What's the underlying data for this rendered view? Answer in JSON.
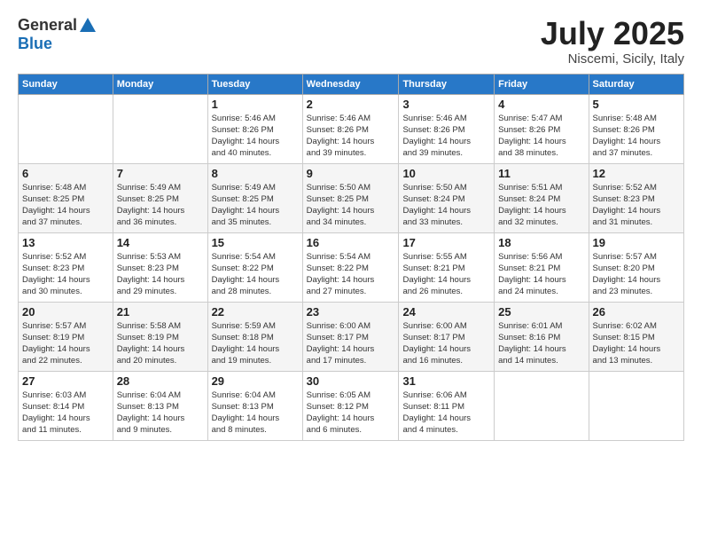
{
  "logo": {
    "general": "General",
    "blue": "Blue"
  },
  "title": "July 2025",
  "subtitle": "Niscemi, Sicily, Italy",
  "days_header": [
    "Sunday",
    "Monday",
    "Tuesday",
    "Wednesday",
    "Thursday",
    "Friday",
    "Saturday"
  ],
  "weeks": [
    [
      {
        "day": "",
        "info": ""
      },
      {
        "day": "",
        "info": ""
      },
      {
        "day": "1",
        "info": "Sunrise: 5:46 AM\nSunset: 8:26 PM\nDaylight: 14 hours\nand 40 minutes."
      },
      {
        "day": "2",
        "info": "Sunrise: 5:46 AM\nSunset: 8:26 PM\nDaylight: 14 hours\nand 39 minutes."
      },
      {
        "day": "3",
        "info": "Sunrise: 5:46 AM\nSunset: 8:26 PM\nDaylight: 14 hours\nand 39 minutes."
      },
      {
        "day": "4",
        "info": "Sunrise: 5:47 AM\nSunset: 8:26 PM\nDaylight: 14 hours\nand 38 minutes."
      },
      {
        "day": "5",
        "info": "Sunrise: 5:48 AM\nSunset: 8:26 PM\nDaylight: 14 hours\nand 37 minutes."
      }
    ],
    [
      {
        "day": "6",
        "info": "Sunrise: 5:48 AM\nSunset: 8:25 PM\nDaylight: 14 hours\nand 37 minutes."
      },
      {
        "day": "7",
        "info": "Sunrise: 5:49 AM\nSunset: 8:25 PM\nDaylight: 14 hours\nand 36 minutes."
      },
      {
        "day": "8",
        "info": "Sunrise: 5:49 AM\nSunset: 8:25 PM\nDaylight: 14 hours\nand 35 minutes."
      },
      {
        "day": "9",
        "info": "Sunrise: 5:50 AM\nSunset: 8:25 PM\nDaylight: 14 hours\nand 34 minutes."
      },
      {
        "day": "10",
        "info": "Sunrise: 5:50 AM\nSunset: 8:24 PM\nDaylight: 14 hours\nand 33 minutes."
      },
      {
        "day": "11",
        "info": "Sunrise: 5:51 AM\nSunset: 8:24 PM\nDaylight: 14 hours\nand 32 minutes."
      },
      {
        "day": "12",
        "info": "Sunrise: 5:52 AM\nSunset: 8:23 PM\nDaylight: 14 hours\nand 31 minutes."
      }
    ],
    [
      {
        "day": "13",
        "info": "Sunrise: 5:52 AM\nSunset: 8:23 PM\nDaylight: 14 hours\nand 30 minutes."
      },
      {
        "day": "14",
        "info": "Sunrise: 5:53 AM\nSunset: 8:23 PM\nDaylight: 14 hours\nand 29 minutes."
      },
      {
        "day": "15",
        "info": "Sunrise: 5:54 AM\nSunset: 8:22 PM\nDaylight: 14 hours\nand 28 minutes."
      },
      {
        "day": "16",
        "info": "Sunrise: 5:54 AM\nSunset: 8:22 PM\nDaylight: 14 hours\nand 27 minutes."
      },
      {
        "day": "17",
        "info": "Sunrise: 5:55 AM\nSunset: 8:21 PM\nDaylight: 14 hours\nand 26 minutes."
      },
      {
        "day": "18",
        "info": "Sunrise: 5:56 AM\nSunset: 8:21 PM\nDaylight: 14 hours\nand 24 minutes."
      },
      {
        "day": "19",
        "info": "Sunrise: 5:57 AM\nSunset: 8:20 PM\nDaylight: 14 hours\nand 23 minutes."
      }
    ],
    [
      {
        "day": "20",
        "info": "Sunrise: 5:57 AM\nSunset: 8:19 PM\nDaylight: 14 hours\nand 22 minutes."
      },
      {
        "day": "21",
        "info": "Sunrise: 5:58 AM\nSunset: 8:19 PM\nDaylight: 14 hours\nand 20 minutes."
      },
      {
        "day": "22",
        "info": "Sunrise: 5:59 AM\nSunset: 8:18 PM\nDaylight: 14 hours\nand 19 minutes."
      },
      {
        "day": "23",
        "info": "Sunrise: 6:00 AM\nSunset: 8:17 PM\nDaylight: 14 hours\nand 17 minutes."
      },
      {
        "day": "24",
        "info": "Sunrise: 6:00 AM\nSunset: 8:17 PM\nDaylight: 14 hours\nand 16 minutes."
      },
      {
        "day": "25",
        "info": "Sunrise: 6:01 AM\nSunset: 8:16 PM\nDaylight: 14 hours\nand 14 minutes."
      },
      {
        "day": "26",
        "info": "Sunrise: 6:02 AM\nSunset: 8:15 PM\nDaylight: 14 hours\nand 13 minutes."
      }
    ],
    [
      {
        "day": "27",
        "info": "Sunrise: 6:03 AM\nSunset: 8:14 PM\nDaylight: 14 hours\nand 11 minutes."
      },
      {
        "day": "28",
        "info": "Sunrise: 6:04 AM\nSunset: 8:13 PM\nDaylight: 14 hours\nand 9 minutes."
      },
      {
        "day": "29",
        "info": "Sunrise: 6:04 AM\nSunset: 8:13 PM\nDaylight: 14 hours\nand 8 minutes."
      },
      {
        "day": "30",
        "info": "Sunrise: 6:05 AM\nSunset: 8:12 PM\nDaylight: 14 hours\nand 6 minutes."
      },
      {
        "day": "31",
        "info": "Sunrise: 6:06 AM\nSunset: 8:11 PM\nDaylight: 14 hours\nand 4 minutes."
      },
      {
        "day": "",
        "info": ""
      },
      {
        "day": "",
        "info": ""
      }
    ]
  ]
}
